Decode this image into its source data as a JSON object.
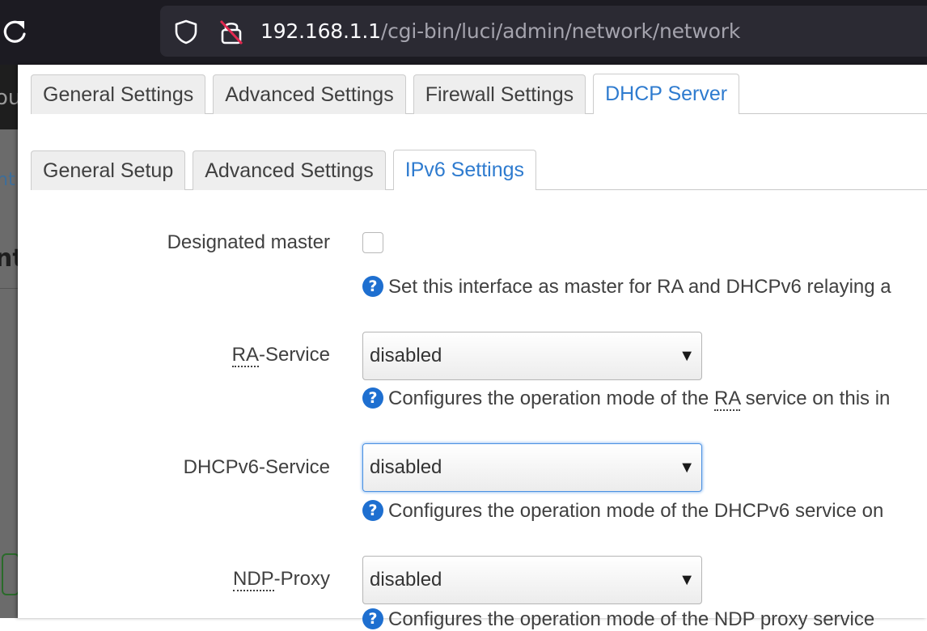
{
  "browser": {
    "url_host": "192.168.1.1",
    "url_path": "/cgi-bin/luci/admin/network/network"
  },
  "background_page": {
    "header_fragment": "ou",
    "link_fragment": "nt",
    "title_fragment": "nt"
  },
  "main_tabs": [
    {
      "label": "General Settings",
      "active": false
    },
    {
      "label": "Advanced Settings",
      "active": false
    },
    {
      "label": "Firewall Settings",
      "active": false
    },
    {
      "label": "DHCP Server",
      "active": true
    }
  ],
  "sub_tabs": [
    {
      "label": "General Setup",
      "active": false
    },
    {
      "label": "Advanced Settings",
      "active": false
    },
    {
      "label": "IPv6 Settings",
      "active": true
    }
  ],
  "form": {
    "designated_master": {
      "label": "Designated master",
      "checked": false,
      "help": "Set this interface as master for RA and DHCPv6 relaying a"
    },
    "ra_service": {
      "label_abbr": "RA",
      "label_rest": "-Service",
      "value": "disabled",
      "help_before": "Configures the operation mode of the ",
      "help_abbr": "RA",
      "help_after": " service on this in"
    },
    "dhcpv6_service": {
      "label": "DHCPv6-Service",
      "value": "disabled",
      "help": "Configures the operation mode of the DHCPv6 service on"
    },
    "ndp_proxy": {
      "label_abbr": "NDP",
      "label_rest": "-Proxy",
      "value": "disabled",
      "help": "Configures the operation mode of the NDP proxy service"
    }
  },
  "icons": {
    "help_glyph": "?",
    "select_arrow": "▼"
  },
  "colors": {
    "accent": "#2e7bcf",
    "help_icon": "#1e6fd0",
    "browser_bg": "#1c1b22"
  }
}
